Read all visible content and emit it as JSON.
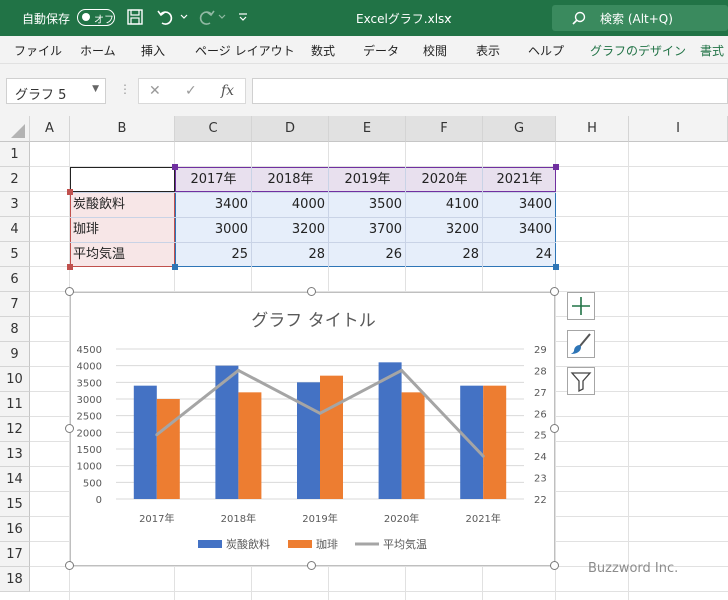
{
  "titlebar": {
    "autosave_label": "自動保存",
    "autosave_state": "オフ",
    "filename": "Excelグラフ.xlsx",
    "search_placeholder": "検索 (Alt+Q)"
  },
  "ribbon_tabs": [
    "ファイル",
    "ホーム",
    "挿入",
    "ページ レイアウト",
    "数式",
    "データ",
    "校閲",
    "表示",
    "ヘルプ",
    "グラフのデザイン",
    "書式"
  ],
  "namebox": {
    "value": "グラフ 5"
  },
  "formula_buttons": {
    "cancel": "✕",
    "enter": "✓",
    "fx": "fx"
  },
  "columns": [
    "A",
    "B",
    "C",
    "D",
    "E",
    "F",
    "G",
    "H",
    "I"
  ],
  "rows": [
    "1",
    "2",
    "3",
    "4",
    "5",
    "6",
    "7",
    "8",
    "9",
    "10",
    "11",
    "12",
    "13",
    "14",
    "15",
    "16",
    "17",
    "18"
  ],
  "table": {
    "header": [
      "2017年",
      "2018年",
      "2019年",
      "2020年",
      "2021年"
    ],
    "rows": [
      {
        "label": "炭酸飲料",
        "values": [
          "3400",
          "4000",
          "3500",
          "4100",
          "3400"
        ]
      },
      {
        "label": "珈琲",
        "values": [
          "3000",
          "3200",
          "3700",
          "3200",
          "3400"
        ]
      },
      {
        "label": "平均気温",
        "values": [
          "25",
          "28",
          "26",
          "28",
          "24"
        ]
      }
    ]
  },
  "chart_data": {
    "type": "bar",
    "title": "グラフ タイトル",
    "categories": [
      "2017年",
      "2018年",
      "2019年",
      "2020年",
      "2021年"
    ],
    "series": [
      {
        "name": "炭酸飲料",
        "type": "bar",
        "axis": "primary",
        "color": "#4472c4",
        "values": [
          3400,
          4000,
          3500,
          4100,
          3400
        ]
      },
      {
        "name": "珈琲",
        "type": "bar",
        "axis": "primary",
        "color": "#ed7d31",
        "values": [
          3000,
          3200,
          3700,
          3200,
          3400
        ]
      },
      {
        "name": "平均気温",
        "type": "line",
        "axis": "secondary",
        "color": "#a5a5a5",
        "values": [
          25,
          28,
          26,
          28,
          24
        ]
      }
    ],
    "ylim": [
      0,
      4500
    ],
    "y_ticks": [
      "0",
      "500",
      "1000",
      "1500",
      "2000",
      "2500",
      "3000",
      "3500",
      "4000",
      "4500"
    ],
    "y2lim": [
      22,
      29
    ],
    "y2_ticks": [
      "22",
      "23",
      "24",
      "25",
      "26",
      "27",
      "28",
      "29"
    ],
    "grid": true,
    "legend": "bottom"
  },
  "watermark": "Buzzword Inc."
}
